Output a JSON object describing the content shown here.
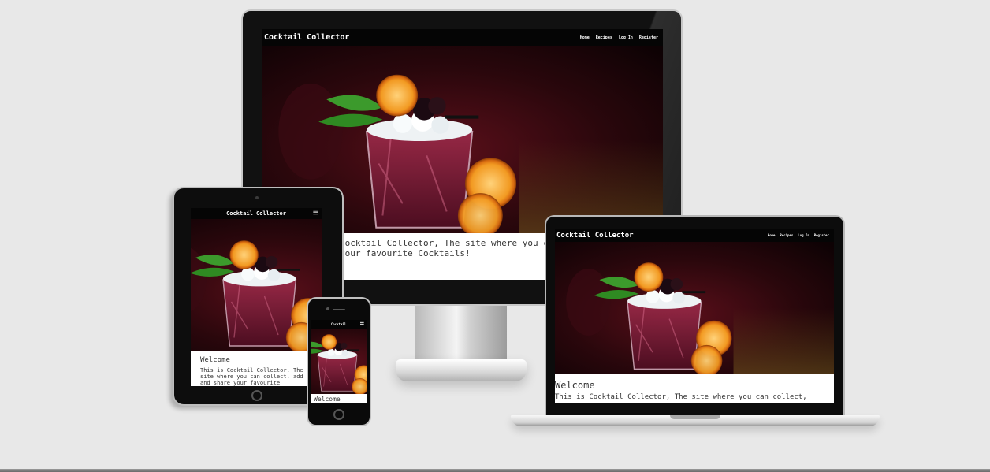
{
  "site": {
    "brand": "Cocktail Collector",
    "brand_short": "Cocktail",
    "nav": [
      "Home",
      "Recipes",
      "Log In",
      "Register"
    ],
    "menu_icon": "hamburger-icon",
    "welcome_title": "Welcome",
    "desktop_welcome_text": "Cocktail Collector, The site where you c share your favourite Cocktails!",
    "tablet_welcome_text": "This is Cocktail Collector, The site where you can collect, add and share your favourite",
    "laptop_welcome_text": "This is Cocktail Collector, The site where you can collect,"
  },
  "colors": {
    "background": "#e8e8e8",
    "nav_background": "#050505",
    "nav_text": "#ffffff",
    "page_text": "#333333",
    "drink": "#7b1f3a",
    "orange": "#f0a030",
    "mint": "#3c9a2c"
  },
  "devices": [
    "desktop-monitor",
    "tablet",
    "phone",
    "laptop"
  ]
}
